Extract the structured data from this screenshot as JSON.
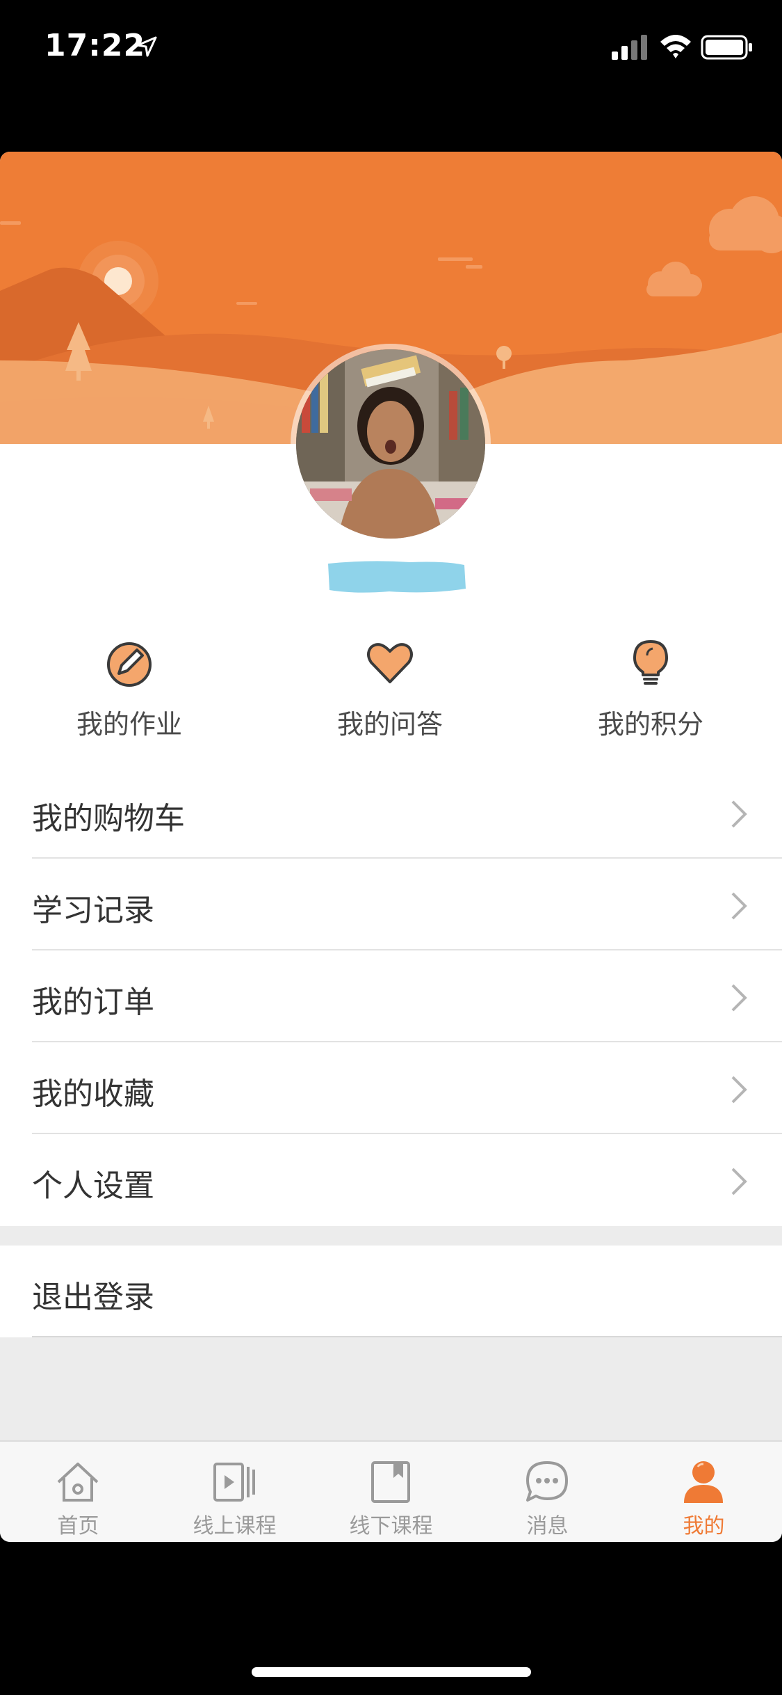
{
  "status_bar": {
    "time": "17:22"
  },
  "profile": {
    "username": ""
  },
  "quick_actions": [
    {
      "label": "我的作业",
      "icon": "pencil-icon"
    },
    {
      "label": "我的问答",
      "icon": "heart-icon"
    },
    {
      "label": "我的积分",
      "icon": "lightbulb-icon"
    }
  ],
  "menu": [
    {
      "label": "我的购物车"
    },
    {
      "label": "学习记录"
    },
    {
      "label": "我的订单"
    },
    {
      "label": "我的收藏"
    },
    {
      "label": "个人设置"
    }
  ],
  "logout_label": "退出登录",
  "tabs": [
    {
      "label": "首页",
      "icon": "home-icon"
    },
    {
      "label": "线上课程",
      "icon": "video-icon"
    },
    {
      "label": "线下课程",
      "icon": "book-icon"
    },
    {
      "label": "消息",
      "icon": "message-icon"
    },
    {
      "label": "我的",
      "icon": "user-icon",
      "active": true
    }
  ],
  "colors": {
    "accent": "#ef7a35",
    "header_orange": "#ee7d36",
    "icon_fill": "#f4a66c",
    "username_redaction": "#8fd3ea"
  }
}
